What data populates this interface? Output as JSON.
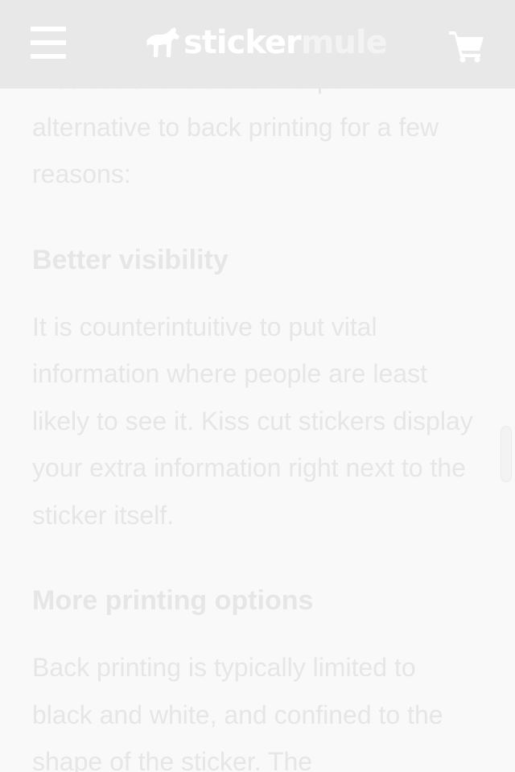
{
  "header": {
    "logo_word1": "sticker",
    "logo_word2": "mule",
    "menu_icon": "hamburger-menu-icon",
    "cart_icon": "shopping-cart-icon"
  },
  "article": {
    "intro": "Kiss cut stickers are a superior alternative to back printing for a few reasons:",
    "sections": [
      {
        "heading": "Better visibility",
        "body": "It is counterintuitive to put vital information where people are least likely to see it. Kiss cut stickers display your extra information right next to the sticker itself."
      },
      {
        "heading": "More printing options",
        "body": "Back printing is typically limited to black and white, and confined to the shape of the sticker. The"
      }
    ]
  },
  "colors": {
    "header_bg": "#e8e8e8",
    "page_bg": "#f9f9f9",
    "text": "#e6e6e6",
    "icon": "#ffffff"
  }
}
